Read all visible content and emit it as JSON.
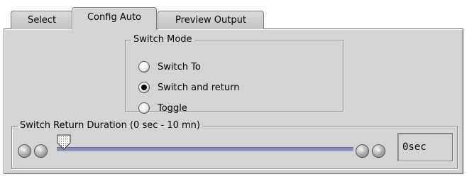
{
  "tabs": [
    {
      "label": "Select",
      "active": false
    },
    {
      "label": "Config Auto",
      "active": true
    },
    {
      "label": "Preview Output",
      "active": false
    }
  ],
  "switch_mode": {
    "legend": "Switch Mode",
    "options": [
      {
        "label": "Switch To",
        "checked": false
      },
      {
        "label": "Switch and return",
        "checked": true
      },
      {
        "label": "Toggle",
        "checked": false
      }
    ]
  },
  "duration": {
    "legend": "Switch Return Duration (0 sec - 10 mn)",
    "value": "0sec",
    "slider_fraction": 0,
    "icons": [
      "rewind-icon",
      "step-back-icon",
      "step-forward-icon",
      "fast-forward-icon"
    ]
  },
  "colors": {
    "panel": "#d4d4d4",
    "track": "#8a8ab6"
  }
}
